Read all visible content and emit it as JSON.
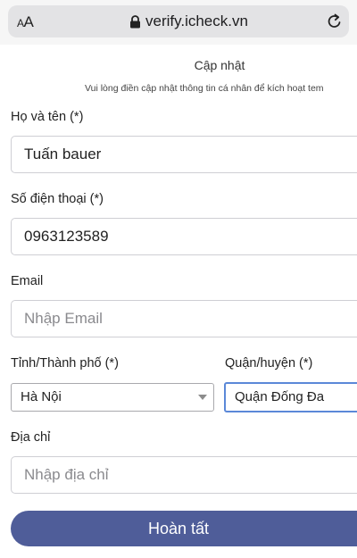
{
  "browser": {
    "text_size_label_small": "A",
    "text_size_label_large": "A",
    "url": "verify.icheck.vn"
  },
  "form": {
    "title": "Cập nhật",
    "subtitle": "Vui lòng điền cập nhật thông tin cá nhân để kích hoạt tem",
    "full_name": {
      "label": "Họ và tên (*)",
      "value": "Tuấn bauer"
    },
    "phone": {
      "label": "Số điện thoại (*)",
      "value": "0963123589"
    },
    "email": {
      "label": "Email",
      "placeholder": "Nhập Email",
      "value": ""
    },
    "province": {
      "label": "Tỉnh/Thành phố (*)",
      "selected": "Hà Nội"
    },
    "district": {
      "label": "Quận/huyện (*)",
      "value": "Quận Đống Đa"
    },
    "address": {
      "label": "Địa chỉ",
      "placeholder": "Nhập địa chỉ",
      "value": ""
    },
    "submit_label": "Hoàn tất"
  }
}
